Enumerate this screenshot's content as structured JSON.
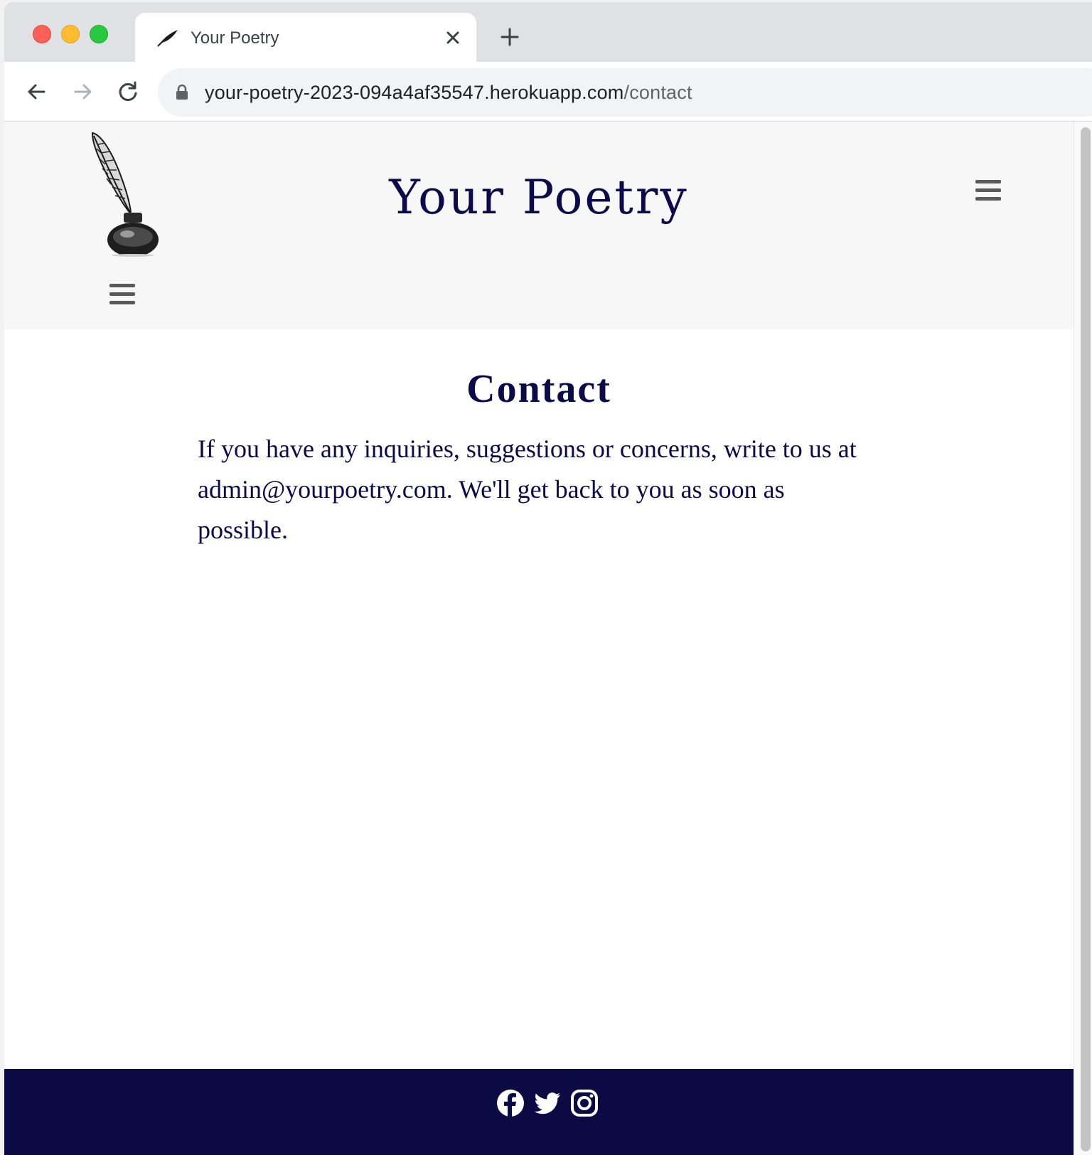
{
  "browser": {
    "tab_title": "Your Poetry",
    "url_host": "your-poetry-2023-094a4af35547.herokuapp.com",
    "url_path": "/contact"
  },
  "site": {
    "title": "Your Poetry"
  },
  "page": {
    "heading": "Contact",
    "body": "If you have any inquiries, suggestions or concerns, write to us at admin@yourpoetry.com. We'll get back to you as soon as possible."
  },
  "footer": {
    "social_icons": [
      "facebook-icon",
      "twitter-icon",
      "instagram-icon"
    ]
  },
  "colors": {
    "brand_navy": "#0c0a4a",
    "footer_bg": "#0c0a44",
    "header_bg": "#f7f7f7"
  }
}
